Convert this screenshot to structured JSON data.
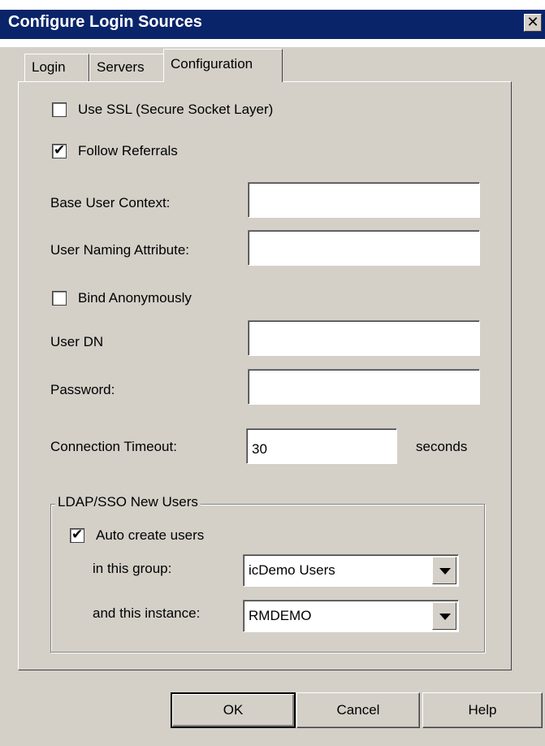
{
  "window": {
    "title": "Configure Login Sources",
    "close_glyph": "✕"
  },
  "tabs": [
    {
      "label": "Login",
      "active": false
    },
    {
      "label": "Servers",
      "active": false
    },
    {
      "label": "Configuration",
      "active": true
    }
  ],
  "config": {
    "use_ssl": {
      "label": "Use SSL (Secure Socket Layer)",
      "checked": false
    },
    "follow_referrals": {
      "label": "Follow Referrals",
      "checked": true
    },
    "base_user_context": {
      "label": "Base User Context:",
      "value": ""
    },
    "user_naming_attribute": {
      "label": "User Naming Attribute:",
      "value": ""
    },
    "bind_anonymously": {
      "label": "Bind Anonymously",
      "checked": false
    },
    "user_dn": {
      "label": "User DN",
      "value": ""
    },
    "password": {
      "label": "Password:",
      "value": ""
    },
    "connection_timeout": {
      "label": "Connection Timeout:",
      "value": "30",
      "unit": "seconds"
    }
  },
  "new_users_group": {
    "legend": "LDAP/SSO New Users",
    "auto_create": {
      "label": "Auto create users",
      "checked": true
    },
    "group": {
      "label": "in this group:",
      "selected": "icDemo Users"
    },
    "instance": {
      "label": "and this instance:",
      "selected": "RMDEMO"
    }
  },
  "buttons": {
    "ok": "OK",
    "cancel": "Cancel",
    "help": "Help"
  },
  "check_glyph": "✔"
}
